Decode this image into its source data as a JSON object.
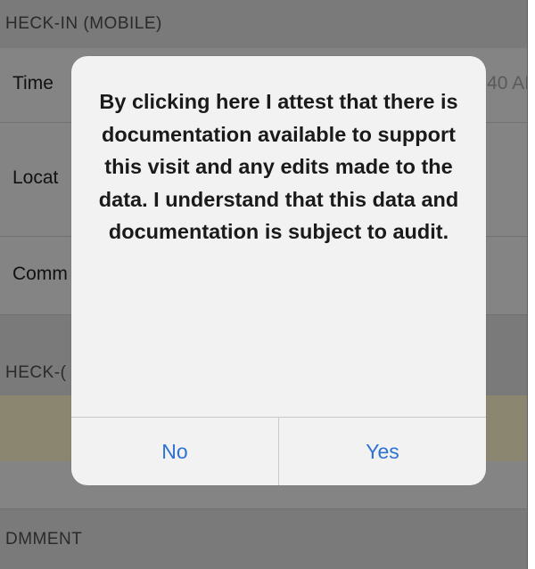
{
  "background_form": {
    "checkin_section_header": "HECK-IN (MOBILE)",
    "time_label": "Time",
    "time_value": "40 AI",
    "location_label": "Locat",
    "comment_label": "Comm",
    "checkout_section_header": "HECK-(",
    "comment_section_header": "DMMENT"
  },
  "alert": {
    "message": "By clicking here I attest that there is documentation available to support this visit and any edits made to the data. I understand that this data and documentation is subject to audit.",
    "no_label": "No",
    "yes_label": "Yes"
  },
  "colors": {
    "button_text": "#2e72d2",
    "dim_background": "#7f7f7f",
    "alert_background": "#f2f2f2"
  }
}
